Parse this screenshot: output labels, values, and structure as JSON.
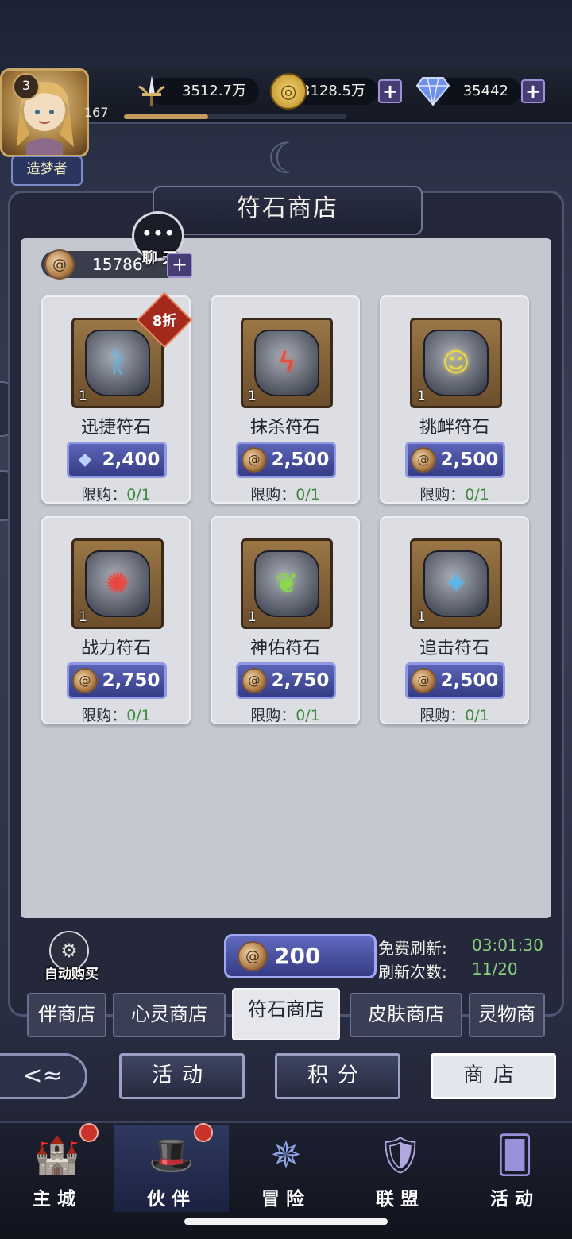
{
  "player": {
    "level": "3",
    "exp_num": "167",
    "title": "造梦者",
    "exp_progress": 0.38
  },
  "resources": {
    "power": "3512.7万",
    "gold": "3128.5万",
    "diamond": "35442"
  },
  "shop": {
    "title": "符石商店",
    "rune_currency": "15786",
    "chat_label": "聊 天"
  },
  "items": [
    {
      "name": "迅捷符石",
      "qty": "1",
      "price": "2,400",
      "currency": "diamond",
      "limit_label": "限购：",
      "limit": "0/1",
      "discount": "8折",
      "glyph": "ᚱ",
      "glow": "#5fb6e8"
    },
    {
      "name": "抹杀符石",
      "qty": "1",
      "price": "2,500",
      "currency": "rune",
      "limit_label": "限购：",
      "limit": "0/1",
      "discount": "",
      "glyph": "ϟ",
      "glow": "#e84a3a"
    },
    {
      "name": "挑衅符石",
      "qty": "1",
      "price": "2,500",
      "currency": "rune",
      "limit_label": "限购：",
      "limit": "0/1",
      "discount": "",
      "glyph": "☺",
      "glow": "#e9d84a"
    },
    {
      "name": "战力符石",
      "qty": "1",
      "price": "2,750",
      "currency": "rune",
      "limit_label": "限购：",
      "limit": "0/1",
      "discount": "",
      "glyph": "✺",
      "glow": "#e8473d"
    },
    {
      "name": "神佑符石",
      "qty": "1",
      "price": "2,750",
      "currency": "rune",
      "limit_label": "限购：",
      "limit": "0/1",
      "discount": "",
      "glyph": "❦",
      "glow": "#8ad94a"
    },
    {
      "name": "追击符石",
      "qty": "1",
      "price": "2,500",
      "currency": "rune",
      "limit_label": "限购：",
      "limit": "0/1",
      "discount": "",
      "glyph": "✦",
      "glow": "#58b8ec"
    }
  ],
  "footer": {
    "auto_buy": "自动购买",
    "refresh_cost": "200",
    "free_refresh_label": "免费刷新:",
    "free_refresh_time": "03:01:30",
    "refresh_count_label": "刷新次数:",
    "refresh_count": "11/20"
  },
  "tabs": [
    "伴商店",
    "心灵商店",
    "符石商店",
    "皮肤商店",
    "灵物商"
  ],
  "subnav": [
    "活动",
    "积分",
    "商店"
  ],
  "bottom_nav": [
    {
      "label": "主城",
      "icon": "castle-icon",
      "dot": true
    },
    {
      "label": "伙伴",
      "icon": "hat-icon",
      "dot": true
    },
    {
      "label": "冒险",
      "icon": "compass-icon",
      "dot": false
    },
    {
      "label": "联盟",
      "icon": "shield-icon",
      "dot": false
    },
    {
      "label": "活动",
      "icon": "cards-icon",
      "dot": false
    }
  ],
  "colors": {
    "accent_purple": "#463b73",
    "limit_green": "#3d8a3e",
    "timer_green": "#8ad17f",
    "discount_red": "#a3291c"
  }
}
